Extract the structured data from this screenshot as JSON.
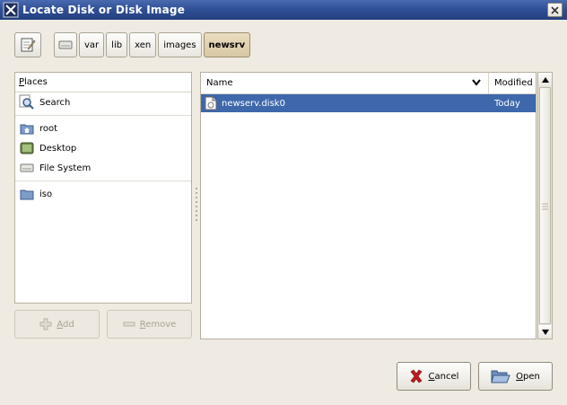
{
  "window": {
    "title": "Locate Disk or Disk Image"
  },
  "pathbar": {
    "crumbs": [
      {
        "label": "var"
      },
      {
        "label": "lib"
      },
      {
        "label": "xen"
      },
      {
        "label": "images"
      },
      {
        "label": "newsrv",
        "active": true
      }
    ]
  },
  "places": {
    "header": {
      "mnemonic": "P",
      "rest": "laces"
    },
    "items": [
      {
        "label": "Search",
        "icon": "search-icon"
      },
      {
        "label": "root",
        "icon": "home-folder-icon"
      },
      {
        "label": "Desktop",
        "icon": "desktop-icon"
      },
      {
        "label": "File System",
        "icon": "drive-icon"
      },
      {
        "label": "iso",
        "icon": "folder-icon"
      }
    ],
    "add_button": {
      "mnemonic": "A",
      "rest": "dd"
    },
    "remove_button": {
      "mnemonic": "R",
      "rest": "emove"
    }
  },
  "files": {
    "columns": {
      "name": "Name",
      "modified": "Modified"
    },
    "rows": [
      {
        "name": "newserv.disk0",
        "modified": "Today",
        "selected": true
      }
    ]
  },
  "buttons": {
    "cancel": {
      "mnemonic": "C",
      "rest": "ancel"
    },
    "open": {
      "mnemonic": "O",
      "rest": "pen"
    }
  },
  "colors": {
    "titlebar": "#2f4f95",
    "selection": "#3e68ab",
    "background": "#efebe2",
    "active_crumb": "#d8c8a4"
  }
}
